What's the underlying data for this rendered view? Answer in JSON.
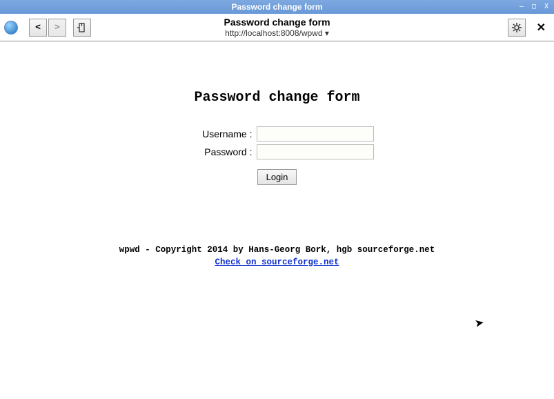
{
  "window": {
    "title": "Password change form",
    "minimize": "–",
    "maximize": "□",
    "close": "X"
  },
  "toolbar": {
    "back": "<",
    "forward": ">",
    "bookmark": "⚲",
    "page_title": "Password change form",
    "url": "http://localhost:8008/wpwd ▾",
    "settings": "✲",
    "close_tab": "✕"
  },
  "form": {
    "heading": "Password change form",
    "username_label": "Username :",
    "username_value": "",
    "password_label": "Password :",
    "password_value": "",
    "login_label": "Login"
  },
  "footer": {
    "copyright": "wpwd - Copyright 2014 by Hans-Georg Bork, hgb sourceforge.net",
    "link_text": "Check on sourceforge.net"
  }
}
